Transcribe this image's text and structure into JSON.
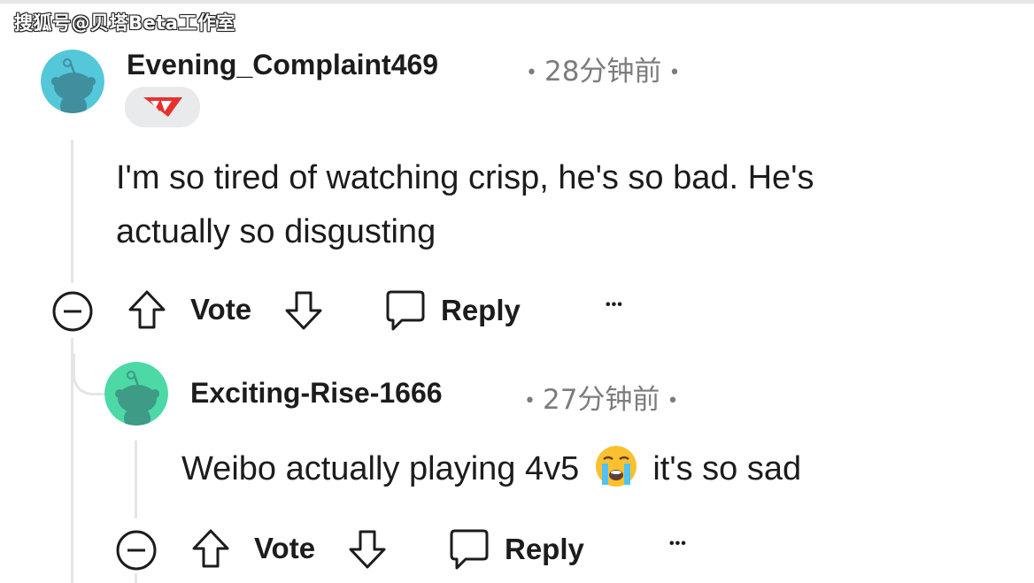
{
  "watermark": "搜狐号@贝塔Beta工作室",
  "comments": [
    {
      "username": "Evening_Complaint469",
      "time": "28分钟前",
      "flair_icon": "team-logo-icon",
      "body_lines": [
        "I'm so tired of watching crisp, he's so bad. He's",
        "actually so disgusting"
      ],
      "actions": {
        "vote_label": "Vote",
        "reply_label": "Reply",
        "more_label": "•••"
      },
      "avatar_color": "#54c7d9"
    },
    {
      "username": "Exciting-Rise-1666",
      "time": "27分钟前",
      "body_before": "Weibo actually playing 4v5",
      "emoji": "loudly-crying-face-icon",
      "body_after": "it's so sad",
      "actions": {
        "vote_label": "Vote",
        "reply_label": "Reply",
        "more_label": "•••"
      },
      "avatar_color": "#4cd9a6"
    }
  ],
  "colors": {
    "text": "#1c1c1c",
    "meta": "#7c7c7c",
    "thread_line": "#e3e6e8",
    "flair_bg": "#e9eaec",
    "flair_red": "#e8312f"
  }
}
